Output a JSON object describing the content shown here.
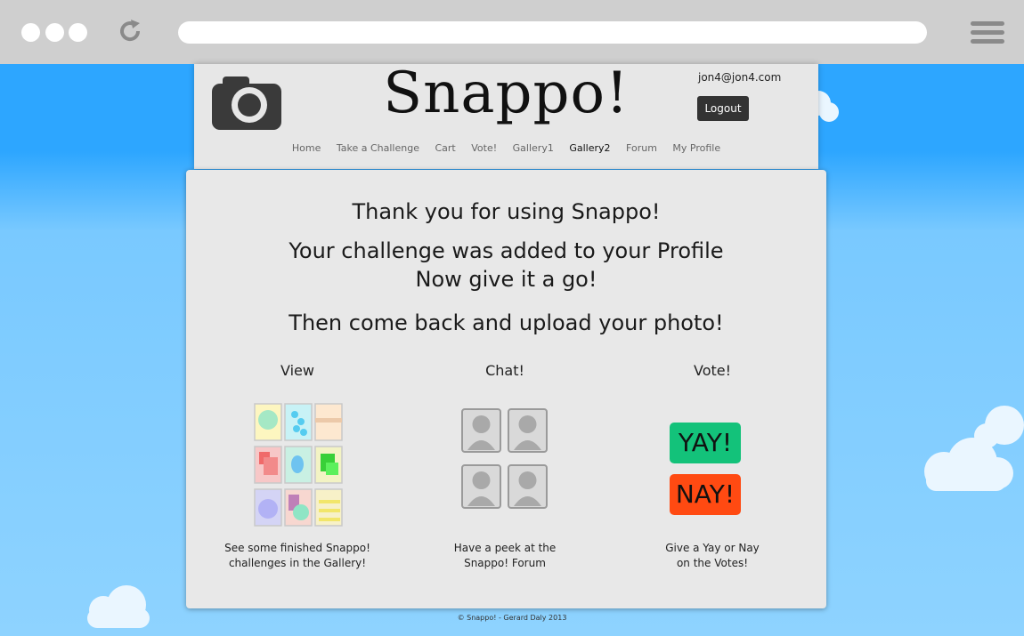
{
  "browser": {
    "window_controls": [
      "dot",
      "dot",
      "dot"
    ],
    "reload_icon": "reload-icon",
    "menu_icon": "hamburger-menu-icon"
  },
  "header": {
    "logo_text": "Snappo!",
    "user_email": "jon4@jon4.com",
    "logout_label": "Logout",
    "nav": [
      "Home",
      "Take a Challenge",
      "Cart",
      "Vote!",
      "Gallery1",
      "Gallery2",
      "Forum",
      "My Profile"
    ],
    "active_nav": "Gallery2"
  },
  "main": {
    "line1": "Thank you for using Snappo!",
    "line2": "Your challenge was added to your Profile",
    "line3": "Now give it a go!",
    "line4": "Then come back and upload your photo!",
    "columns": [
      {
        "title": "View",
        "desc1": "See some finished Snappo!",
        "desc2": "challenges in the Gallery!"
      },
      {
        "title": "Chat!",
        "desc1": "Have a peek at the",
        "desc2": "Snappo! Forum"
      },
      {
        "title": "Vote!",
        "desc1": "Give a Yay or Nay",
        "desc2": "on the Votes!"
      }
    ],
    "yay_label": "YAY!",
    "nay_label": "NAY!"
  },
  "colors": {
    "yay": "#13c27a",
    "nay": "#ff4a12",
    "logout": "#333333",
    "panel": "#e8e8e8"
  },
  "footer": "© Snappo! - Gerard Daly 2013"
}
